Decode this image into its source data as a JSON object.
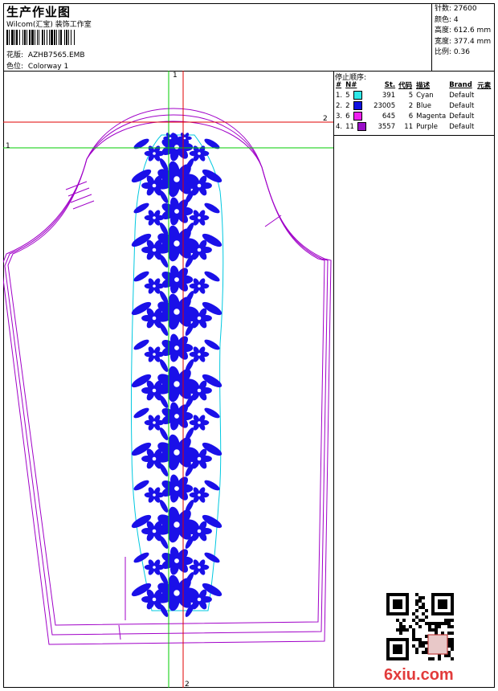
{
  "header": {
    "title": "生产作业图",
    "subtitle": "Wilcom(汇宝) 装饰工作室",
    "design_label": "花版:",
    "design_value": "AZHB7565.EMB",
    "colorway_label": "色位:",
    "colorway_value": "Colorway 1"
  },
  "stats": [
    {
      "label": "针数:",
      "value": "27600"
    },
    {
      "label": "颜色:",
      "value": "4"
    },
    {
      "label": "高度:",
      "value": "612.6 mm"
    },
    {
      "label": "宽度:",
      "value": "377.4 mm"
    },
    {
      "label": "比例:",
      "value": "0.36"
    }
  ],
  "sequence": {
    "title": "停止顺序:",
    "columns": [
      "#",
      "N#",
      "St.",
      "代码",
      "描述",
      "Brand",
      "元素"
    ],
    "rows": [
      {
        "idx": "1.",
        "n": "5",
        "color": "#2ee8e8",
        "st": "391",
        "code": "5",
        "desc": "Cyan",
        "brand": "Default"
      },
      {
        "idx": "2.",
        "n": "2",
        "color": "#1010e0",
        "st": "23005",
        "code": "2",
        "desc": "Blue",
        "brand": "Default"
      },
      {
        "idx": "3.",
        "n": "6",
        "color": "#f020f0",
        "st": "645",
        "code": "6",
        "desc": "Magenta",
        "brand": "Default"
      },
      {
        "idx": "4.",
        "n": "11",
        "color": "#9a10c8",
        "st": "3557",
        "code": "11",
        "desc": "Purple",
        "brand": "Default"
      }
    ]
  },
  "markers": {
    "green": "1",
    "red": "2"
  },
  "colors": {
    "guide_green": "#00cc00",
    "guide_red": "#e00000",
    "outline": "#a000c8",
    "motif": "#1a10e8",
    "boundary": "#00c8e0"
  },
  "watermark": "6xiu.com"
}
